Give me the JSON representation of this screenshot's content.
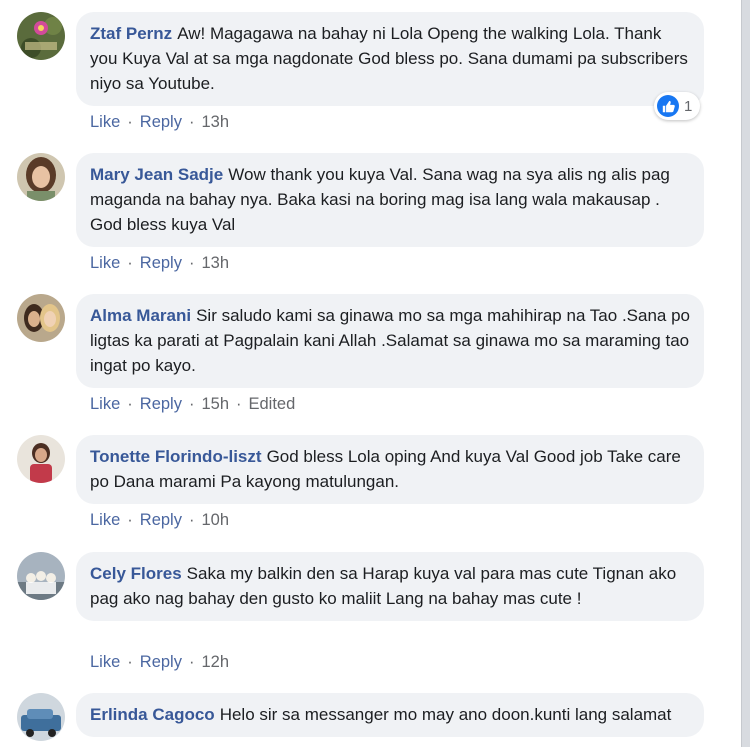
{
  "icons": {
    "reaction": "thumbs-up-icon"
  },
  "colors": {
    "author": "#385898",
    "bubble": "#f0f2f5",
    "meta": "#65676b",
    "like": "#1877f2"
  },
  "comments": [
    {
      "author": "Ztaf Pernz",
      "text": "Aw! Magagawa na bahay ni Lola Openg the walking Lola. Thank you Kuya Val at sa mga nagdonate God bless po. Sana dumami pa subscribers niyo sa Youtube.",
      "like": "Like",
      "reply": "Reply",
      "time": "13h",
      "reaction_count": "1"
    },
    {
      "author": "Mary Jean Sadje",
      "text": "Wow thank you kuya Val. Sana wag na sya alis ng alis pag maganda na bahay nya. Baka kasi na boring mag isa lang wala makausap . God bless kuya Val",
      "like": "Like",
      "reply": "Reply",
      "time": "13h"
    },
    {
      "author": "Alma Marani",
      "text": "Sir saludo kami sa ginawa mo sa mga mahihirap na Tao .Sana po ligtas ka parati at Pagpalain kani Allah .Salamat sa ginawa mo sa maraming tao ingat po kayo.",
      "like": "Like",
      "reply": "Reply",
      "time": "15h",
      "edited": "Edited"
    },
    {
      "author": "Tonette Florindo-liszt",
      "text": "God bless Lola oping And kuya Val Good job Take care po Dana marami Pa kayong matulungan.",
      "like": "Like",
      "reply": "Reply",
      "time": "10h"
    },
    {
      "author": "Cely Flores",
      "text": "Saka my balkin den sa Harap kuya val para mas cute Tignan ako pag ako nag bahay den gusto ko maliit Lang na bahay mas cute !",
      "like": "Like",
      "reply": "Reply",
      "time": "12h"
    },
    {
      "author": "Erlinda Cagoco",
      "text": "Helo sir sa messanger mo may ano doon.kunti lang salamat"
    }
  ]
}
